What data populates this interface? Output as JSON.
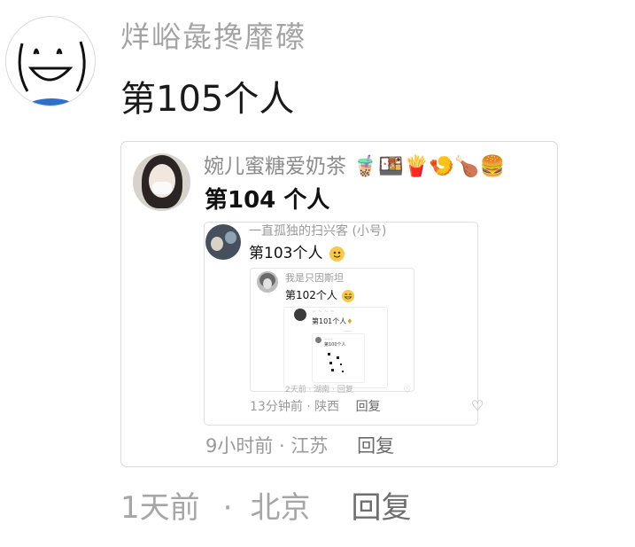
{
  "comment": {
    "username": "烊峪彘搀靡礤",
    "text": "第105个人",
    "time": "1天前",
    "separator": "·",
    "location": "北京",
    "reply_label": "回复"
  },
  "quote1": {
    "username": "婉儿蜜糖爱奶茶",
    "username_emojis": "🧋🍱🍟🍤🍗🍔",
    "text": "第104 个人",
    "meta": "9小时前 · 江苏",
    "reply_label": "回复"
  },
  "quote2": {
    "username": "一直孤独的扫兴客 (小号)",
    "text": "第103个人",
    "meta": "13分钟前 · 陕西",
    "reply_label": "回复"
  },
  "quote3": {
    "username": "我是只因斯坦",
    "text": "第102个人",
    "meta": "2天前 · 湖南 · 回复"
  },
  "quote4": {
    "text": "第101个人"
  },
  "quote5": {
    "text": "第100个人"
  }
}
